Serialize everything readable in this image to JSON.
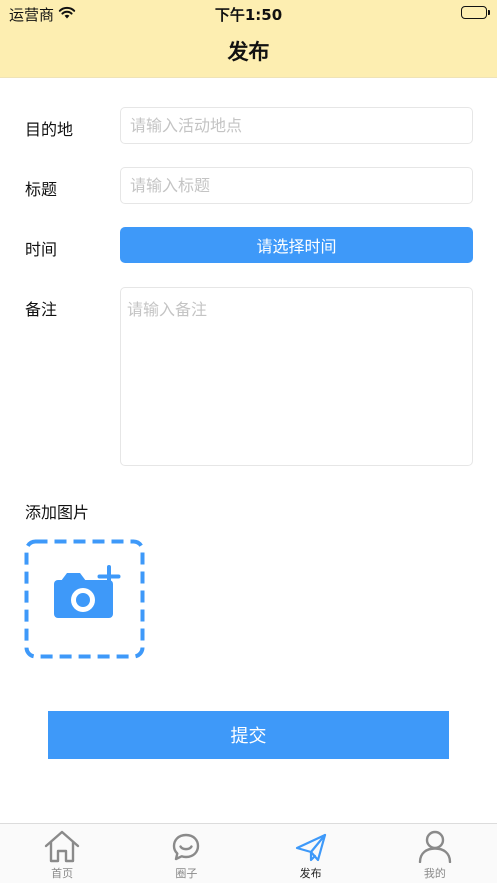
{
  "status_bar": {
    "carrier": "运营商",
    "time": "下午1:50"
  },
  "header": {
    "title": "发布"
  },
  "form": {
    "destination": {
      "label": "目的地",
      "placeholder": "请输入活动地点",
      "value": ""
    },
    "title": {
      "label": "标题",
      "placeholder": "请输入标题",
      "value": ""
    },
    "time": {
      "label": "时间",
      "button_label": "请选择时间"
    },
    "remark": {
      "label": "备注",
      "placeholder": "请输入备注",
      "value": ""
    },
    "photos": {
      "label": "添加图片",
      "add_icon": "camera-plus-icon"
    }
  },
  "submit_label": "提交",
  "tab_bar": {
    "items": [
      {
        "label": "首页",
        "icon": "home-icon",
        "active": false
      },
      {
        "label": "圈子",
        "icon": "chat-bubble-icon",
        "active": false
      },
      {
        "label": "发布",
        "icon": "paper-plane-icon",
        "active": true
      },
      {
        "label": "我的",
        "icon": "user-icon",
        "active": false
      }
    ]
  },
  "colors": {
    "header_bg": "#fdeeb1",
    "accent": "#3e99f9",
    "placeholder": "#c4c4c4",
    "tab_inactive": "#8a8a8a"
  }
}
